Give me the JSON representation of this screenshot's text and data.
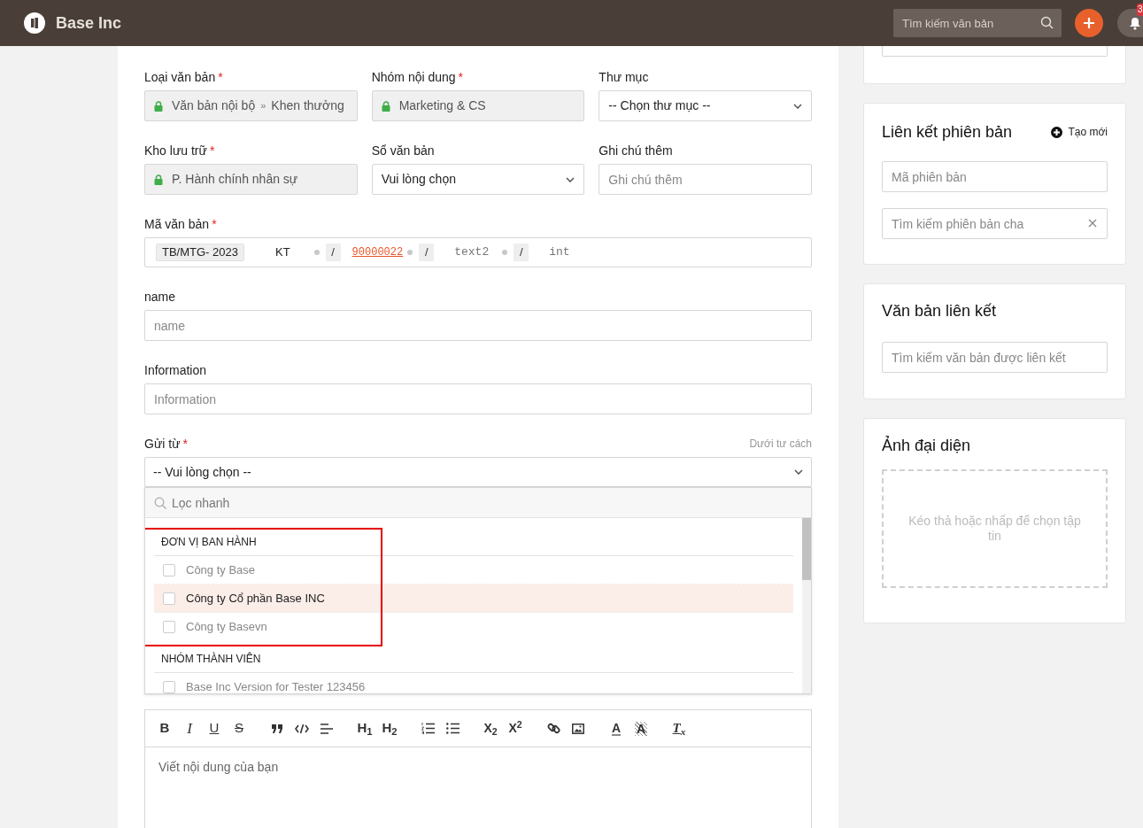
{
  "topbar": {
    "brand": "Base Inc",
    "search": {
      "placeholder": "Tìm kiếm văn bản"
    },
    "notifications": {
      "badge": "3"
    }
  },
  "form": {
    "rows": [
      [
        {
          "kind": "locked",
          "label": "Loại văn bản",
          "required_mark": "*",
          "path": [
            "Văn bản nội bộ",
            "Khen thưởng"
          ],
          "separator": "»"
        },
        {
          "kind": "locked",
          "label": "Nhóm nội dung",
          "required_mark": "*",
          "path": [
            "Marketing & CS"
          ]
        },
        {
          "kind": "select",
          "label": "Thư mục",
          "value": "-- Chọn thư mục --"
        }
      ],
      [
        {
          "kind": "locked",
          "label": "Kho lưu trữ",
          "required_mark": "*",
          "path": [
            "P. Hành chính nhân sự"
          ]
        },
        {
          "kind": "select",
          "label": "Sổ văn bản",
          "value": "Vui lòng chọn"
        },
        {
          "kind": "input",
          "label": "Ghi chú thêm",
          "placeholder": "Ghi chú thêm"
        }
      ]
    ],
    "code_field": {
      "label": "Mã văn bản",
      "required_mark": "*",
      "segments": [
        {
          "kind": "chip",
          "text": "TB/MTG- 2023"
        },
        {
          "kind": "plain",
          "text": "KT"
        },
        {
          "kind": "dot"
        },
        {
          "kind": "slash",
          "text": "/"
        },
        {
          "kind": "link",
          "text": "90000022"
        },
        {
          "kind": "dot"
        },
        {
          "kind": "slash",
          "text": "/"
        },
        {
          "kind": "mono",
          "text": "text2"
        },
        {
          "kind": "dot"
        },
        {
          "kind": "slash",
          "text": "/"
        },
        {
          "kind": "mono",
          "text": "int"
        }
      ]
    },
    "text_fields": [
      {
        "label": "name",
        "placeholder": "name"
      },
      {
        "label": "Information",
        "placeholder": "Information"
      }
    ],
    "send_from": {
      "label": "Gửi từ",
      "required_mark": "*",
      "hint": "Dưới tư cách",
      "value": "-- Vui lòng chọn --",
      "dropdown": {
        "open": true,
        "filter_placeholder": "Lọc nhanh",
        "groups": [
          {
            "title": "ĐƠN VỊ BAN HÀNH",
            "outlined": true,
            "items": [
              {
                "label": "Công ty Base",
                "checked": false,
                "selected": false
              },
              {
                "label": "Công ty Cổ phần Base INC",
                "checked": false,
                "selected": true
              },
              {
                "label": "Công ty Basevn",
                "checked": false,
                "selected": false
              }
            ]
          },
          {
            "title": "NHÓM THÀNH VIÊN",
            "outlined": false,
            "items": [
              {
                "label": "Base Inc Version for Tester 123456",
                "checked": false,
                "selected": false
              }
            ]
          }
        ]
      }
    },
    "content": {
      "placeholder": "Viết nội dung của bạn",
      "toolbar": [
        [
          {
            "kind": "bold",
            "text": "B"
          },
          {
            "kind": "italic",
            "text": "I"
          },
          {
            "kind": "underline",
            "text": "U"
          },
          {
            "kind": "strike",
            "text": "S"
          }
        ],
        [
          {
            "kind": "quote"
          },
          {
            "kind": "code"
          },
          {
            "kind": "align"
          }
        ],
        [
          {
            "kind": "heading",
            "text": "H$_{1}$"
          },
          {
            "kind": "heading",
            "text": "H$_{2}$"
          }
        ],
        [
          {
            "kind": "ordered-list"
          },
          {
            "kind": "bullet-list"
          }
        ],
        [
          {
            "kind": "script",
            "text": "X$_{2}$"
          },
          {
            "kind": "script",
            "text": "X$^{2}$"
          }
        ],
        [
          {
            "kind": "link"
          },
          {
            "kind": "image"
          }
        ],
        [
          {
            "kind": "text-color",
            "text": "A"
          },
          {
            "kind": "highlight",
            "text": "A"
          }
        ],
        [
          {
            "kind": "clear-format",
            "text": "T$_{x}$"
          }
        ]
      ]
    }
  },
  "side": {
    "version_link": {
      "title": "Liên kết phiên bản",
      "create_link": "Tạo mới",
      "fields": [
        {
          "placeholder": "Mã phiên bản",
          "clearable": false
        },
        {
          "placeholder": "Tìm kiếm phiên bản cha",
          "clearable": true
        }
      ]
    },
    "linked_docs": {
      "title": "Văn bản liên kết",
      "placeholder": "Tìm kiếm văn bản được liên kết"
    },
    "avatar": {
      "title": "Ảnh đại diện",
      "drop_text": "Kéo thả hoặc nhấp để chọn tập tin"
    }
  }
}
